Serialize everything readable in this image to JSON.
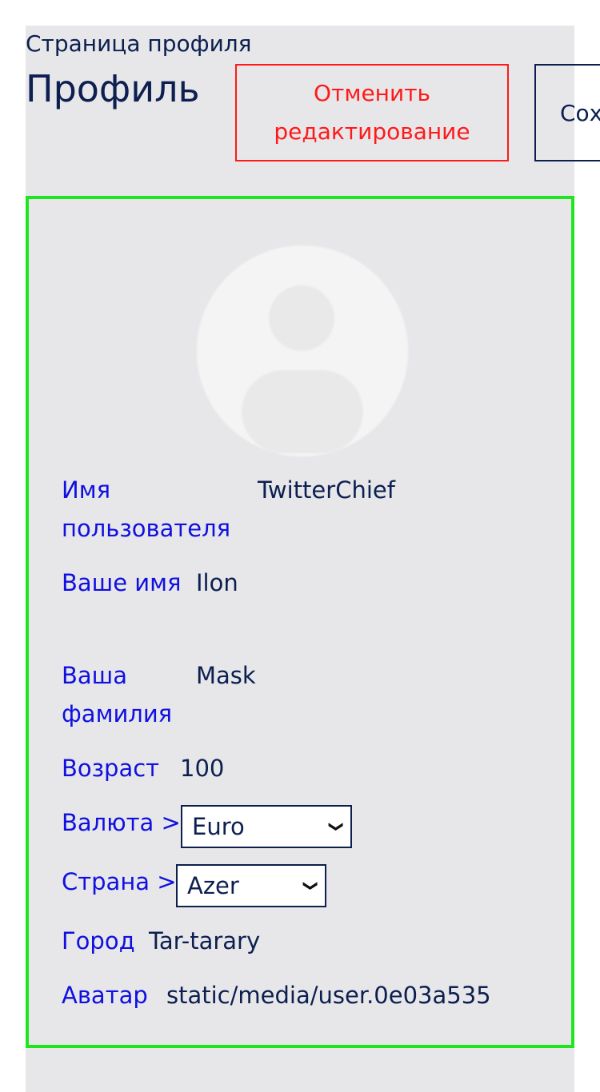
{
  "header": {
    "subtitle": "Страница профиля",
    "title": "Профиль",
    "cancel_label": "Отменить редактирование",
    "save_label": "Сохранить"
  },
  "profile": {
    "username_label": "Имя пользователя",
    "username_value": "TwitterChief",
    "firstname_label": "Ваше имя",
    "firstname_value": "Ilon",
    "lastname_label": "Ваша фамилия",
    "lastname_value": "Mask",
    "age_label": "Возраст",
    "age_value": "100",
    "currency_label": "Валюта >",
    "currency_value": "Euro",
    "country_label": "Страна >",
    "country_value": "Azer",
    "city_label": "Город",
    "city_value": "Tar-tarary",
    "avatar_label": "Аватар",
    "avatar_value": "static/media/user.0e03a535"
  },
  "colors": {
    "text_dark": "#0c1f4f",
    "label_blue": "#1010e0",
    "cancel_red": "#ff1a1a",
    "card_border_green": "#1ee61e",
    "panel_bg": "#e7e7ea"
  },
  "icons": {
    "avatar": "default-user-avatar-icon",
    "dropdown": "chevron-down-icon"
  }
}
